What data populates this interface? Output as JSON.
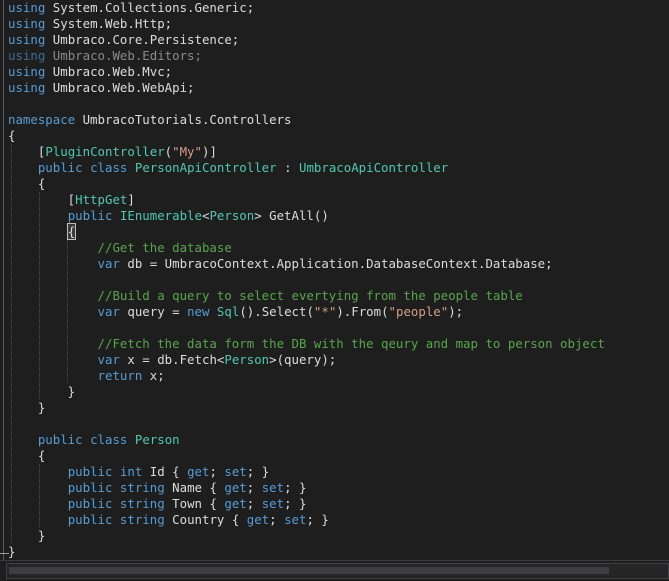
{
  "editor": {
    "lines": [
      {
        "i": 0,
        "tokens": [
          [
            "kw",
            "using"
          ],
          [
            "plain",
            " System.Collections.Generic;"
          ]
        ]
      },
      {
        "i": 1,
        "tokens": [
          [
            "kw",
            "using"
          ],
          [
            "plain",
            " System.Web.Http;"
          ]
        ]
      },
      {
        "i": 2,
        "tokens": [
          [
            "kw",
            "using"
          ],
          [
            "plain",
            " Umbraco.Core.Persistence;"
          ]
        ]
      },
      {
        "i": 3,
        "tokens": [
          [
            "kwdim",
            "using"
          ],
          [
            "dim",
            " Umbraco.Web.Editors;"
          ]
        ]
      },
      {
        "i": 4,
        "tokens": [
          [
            "kw",
            "using"
          ],
          [
            "plain",
            " Umbraco.Web.Mvc;"
          ]
        ]
      },
      {
        "i": 5,
        "tokens": [
          [
            "kw",
            "using"
          ],
          [
            "plain",
            " Umbraco.Web.WebApi;"
          ]
        ]
      },
      {
        "i": 6,
        "tokens": []
      },
      {
        "i": 7,
        "tokens": [
          [
            "kw",
            "namespace"
          ],
          [
            "plain",
            " UmbracoTutorials.Controllers"
          ]
        ]
      },
      {
        "i": 8,
        "tokens": [
          [
            "plain",
            "{"
          ]
        ]
      },
      {
        "i": 9,
        "tokens": [
          [
            "plain",
            "    ["
          ],
          [
            "ty",
            "PluginController"
          ],
          [
            "plain",
            "("
          ],
          [
            "str",
            "\"My\""
          ],
          [
            "plain",
            ")]"
          ]
        ]
      },
      {
        "i": 10,
        "tokens": [
          [
            "plain",
            "    "
          ],
          [
            "kw",
            "public"
          ],
          [
            "plain",
            " "
          ],
          [
            "kw",
            "class"
          ],
          [
            "plain",
            " "
          ],
          [
            "ty",
            "PersonApiController"
          ],
          [
            "plain",
            " : "
          ],
          [
            "ty",
            "UmbracoApiController"
          ]
        ]
      },
      {
        "i": 11,
        "tokens": [
          [
            "plain",
            "    {"
          ]
        ]
      },
      {
        "i": 12,
        "tokens": [
          [
            "plain",
            "        ["
          ],
          [
            "ty",
            "HttpGet"
          ],
          [
            "plain",
            "]"
          ]
        ]
      },
      {
        "i": 13,
        "tokens": [
          [
            "plain",
            "        "
          ],
          [
            "kw",
            "public"
          ],
          [
            "plain",
            " "
          ],
          [
            "ty",
            "IEnumerable"
          ],
          [
            "plain",
            "<"
          ],
          [
            "ty",
            "Person"
          ],
          [
            "plain",
            "> GetAll()"
          ]
        ]
      },
      {
        "i": 14,
        "tokens": [
          [
            "plain",
            "        "
          ],
          [
            "brace",
            "{"
          ]
        ]
      },
      {
        "i": 15,
        "tokens": [
          [
            "plain",
            "            "
          ],
          [
            "cm",
            "//Get the database"
          ]
        ]
      },
      {
        "i": 16,
        "tokens": [
          [
            "plain",
            "            "
          ],
          [
            "kw",
            "var"
          ],
          [
            "plain",
            " db = UmbracoContext.Application.DatabaseContext.Database;"
          ]
        ]
      },
      {
        "i": 17,
        "tokens": []
      },
      {
        "i": 18,
        "tokens": [
          [
            "plain",
            "            "
          ],
          [
            "cm",
            "//Build a query to select evertying from the people table"
          ]
        ]
      },
      {
        "i": 19,
        "tokens": [
          [
            "plain",
            "            "
          ],
          [
            "kw",
            "var"
          ],
          [
            "plain",
            " query = "
          ],
          [
            "kw",
            "new"
          ],
          [
            "plain",
            " "
          ],
          [
            "ty",
            "Sql"
          ],
          [
            "plain",
            "().Select("
          ],
          [
            "str",
            "\"*\""
          ],
          [
            "plain",
            ").From("
          ],
          [
            "str",
            "\"people\""
          ],
          [
            "plain",
            ");"
          ]
        ]
      },
      {
        "i": 20,
        "tokens": []
      },
      {
        "i": 21,
        "tokens": [
          [
            "plain",
            "            "
          ],
          [
            "cm",
            "//Fetch the data form the DB with the qeury and map to person object"
          ]
        ]
      },
      {
        "i": 22,
        "tokens": [
          [
            "plain",
            "            "
          ],
          [
            "kw",
            "var"
          ],
          [
            "plain",
            " x = db.Fetch<"
          ],
          [
            "ty",
            "Person"
          ],
          [
            "plain",
            ">(query);"
          ]
        ]
      },
      {
        "i": 23,
        "tokens": [
          [
            "plain",
            "            "
          ],
          [
            "kw",
            "return"
          ],
          [
            "plain",
            " x;"
          ]
        ]
      },
      {
        "i": 24,
        "tokens": [
          [
            "plain",
            "        }"
          ]
        ]
      },
      {
        "i": 25,
        "tokens": [
          [
            "plain",
            "    }"
          ]
        ]
      },
      {
        "i": 26,
        "tokens": []
      },
      {
        "i": 27,
        "tokens": [
          [
            "plain",
            "    "
          ],
          [
            "kw",
            "public"
          ],
          [
            "plain",
            " "
          ],
          [
            "kw",
            "class"
          ],
          [
            "plain",
            " "
          ],
          [
            "ty",
            "Person"
          ]
        ]
      },
      {
        "i": 28,
        "tokens": [
          [
            "plain",
            "    {"
          ]
        ]
      },
      {
        "i": 29,
        "tokens": [
          [
            "plain",
            "        "
          ],
          [
            "kw",
            "public"
          ],
          [
            "plain",
            " "
          ],
          [
            "kw",
            "int"
          ],
          [
            "plain",
            " Id { "
          ],
          [
            "kw",
            "get"
          ],
          [
            "plain",
            "; "
          ],
          [
            "kw",
            "set"
          ],
          [
            "plain",
            "; }"
          ]
        ]
      },
      {
        "i": 30,
        "tokens": [
          [
            "plain",
            "        "
          ],
          [
            "kw",
            "public"
          ],
          [
            "plain",
            " "
          ],
          [
            "kw",
            "string"
          ],
          [
            "plain",
            " Name { "
          ],
          [
            "kw",
            "get"
          ],
          [
            "plain",
            "; "
          ],
          [
            "kw",
            "set"
          ],
          [
            "plain",
            "; }"
          ]
        ]
      },
      {
        "i": 31,
        "tokens": [
          [
            "plain",
            "        "
          ],
          [
            "kw",
            "public"
          ],
          [
            "plain",
            " "
          ],
          [
            "kw",
            "string"
          ],
          [
            "plain",
            " Town { "
          ],
          [
            "kw",
            "get"
          ],
          [
            "plain",
            "; "
          ],
          [
            "kw",
            "set"
          ],
          [
            "plain",
            "; }"
          ]
        ]
      },
      {
        "i": 32,
        "tokens": [
          [
            "plain",
            "        "
          ],
          [
            "kw",
            "public"
          ],
          [
            "plain",
            " "
          ],
          [
            "kw",
            "string"
          ],
          [
            "plain",
            " Country { "
          ],
          [
            "kw",
            "get"
          ],
          [
            "plain",
            "; "
          ],
          [
            "kw",
            "set"
          ],
          [
            "plain",
            "; }"
          ]
        ]
      },
      {
        "i": 33,
        "tokens": [
          [
            "plain",
            "    }"
          ]
        ]
      },
      {
        "i": 34,
        "tokens": [
          [
            "plain",
            "}"
          ]
        ]
      }
    ]
  }
}
